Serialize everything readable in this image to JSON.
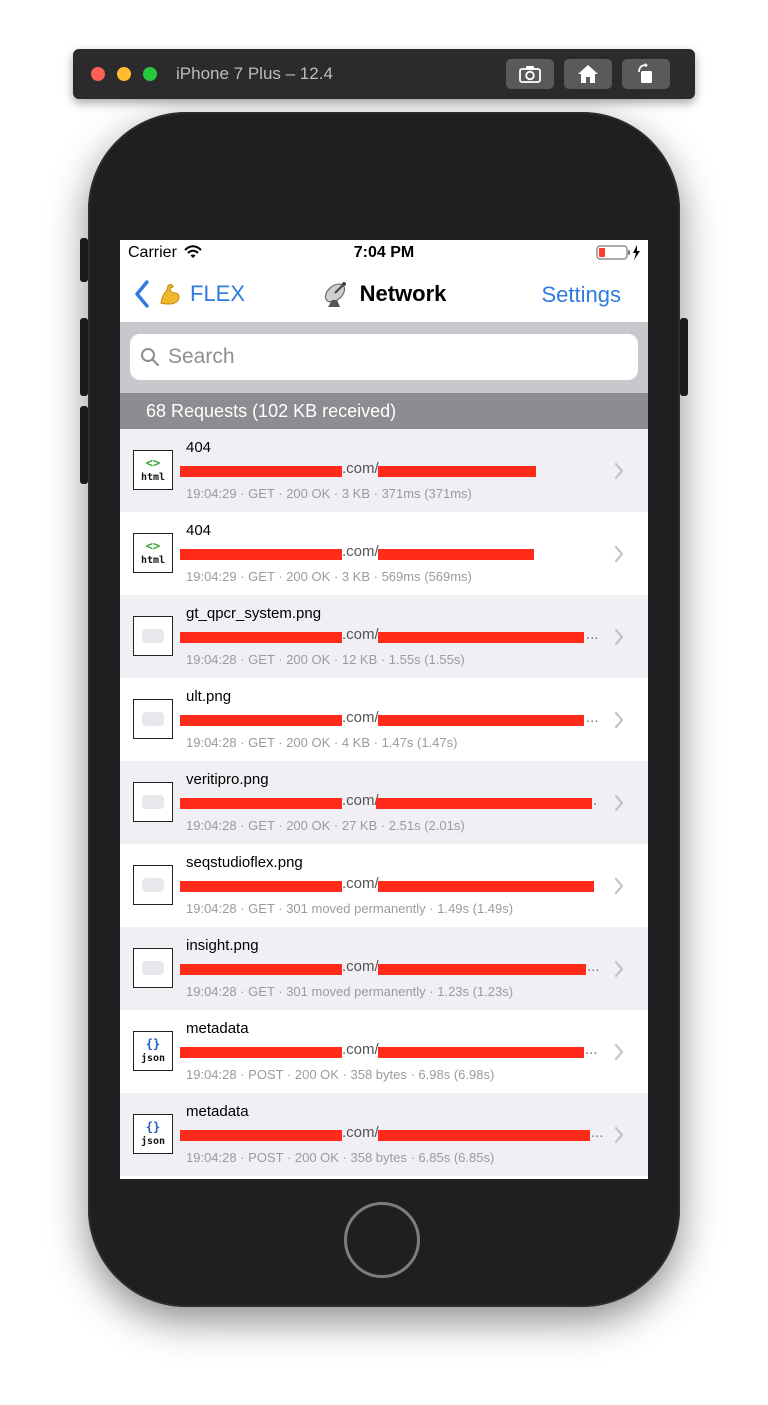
{
  "window": {
    "title": "iPhone 7 Plus – 12.4",
    "toolbar": {
      "screenshot_icon": "camera-icon",
      "home_icon": "home-icon",
      "rotate_icon": "rotate-icon"
    }
  },
  "status_bar": {
    "carrier": "Carrier",
    "time": "7:04 PM"
  },
  "nav": {
    "back_label": "FLEX",
    "title": "Network",
    "settings_label": "Settings"
  },
  "search": {
    "placeholder": "Search",
    "value": ""
  },
  "section": {
    "header": "68 Requests (102 KB received)"
  },
  "requests": [
    {
      "title": "404",
      "url_host": ".com/",
      "url_ellipsis": "",
      "meta": "19:04:29 · GET · 200 OK · 3 KB · 371ms (371ms)",
      "type": "html"
    },
    {
      "title": "404",
      "url_host": ".com/",
      "url_ellipsis": "",
      "meta": "19:04:29 · GET · 200 OK · 3 KB · 569ms (569ms)",
      "type": "html"
    },
    {
      "title": "gt_qpcr_system.png",
      "url_host": ".com/",
      "url_ellipsis": "...",
      "meta": "19:04:28 · GET · 200 OK · 12 KB · 1.55s (1.55s)",
      "type": "image"
    },
    {
      "title": "ult.png",
      "url_host": ".com/",
      "url_ellipsis": "...",
      "meta": "19:04:28 · GET · 200 OK · 4 KB · 1.47s (1.47s)",
      "type": "image"
    },
    {
      "title": "veritipro.png",
      "url_host": ".com/",
      "url_ellipsis": ".",
      "meta": "19:04:28 · GET · 200 OK · 27 KB · 2.51s (2.01s)",
      "type": "image"
    },
    {
      "title": "seqstudioflex.png",
      "url_host": ".com/",
      "url_ellipsis": "",
      "meta": "19:04:28 · GET · 301 moved permanently · 1.49s (1.49s)",
      "type": "image"
    },
    {
      "title": "insight.png",
      "url_host": ".com/",
      "url_ellipsis": "...",
      "meta": "19:04:28 · GET · 301 moved permanently · 1.23s (1.23s)",
      "type": "image"
    },
    {
      "title": "metadata",
      "url_host": ".com/",
      "url_ellipsis": "...",
      "meta": "19:04:28 · POST · 200 OK · 358 bytes · 6.98s (6.98s)",
      "type": "json"
    },
    {
      "title": "metadata",
      "url_host": ".com/",
      "url_ellipsis": "...",
      "meta": "19:04:28 · POST · 200 OK · 358 bytes · 6.85s (6.85s)",
      "type": "json"
    }
  ],
  "thumb_labels": {
    "html_glyph": "<>",
    "html_text": "html",
    "json_glyph": "{}",
    "json_text": "json"
  },
  "colors": {
    "accent": "#2f7bde",
    "redaction": "#ff2a1a",
    "section_header": "#8d8d91"
  }
}
